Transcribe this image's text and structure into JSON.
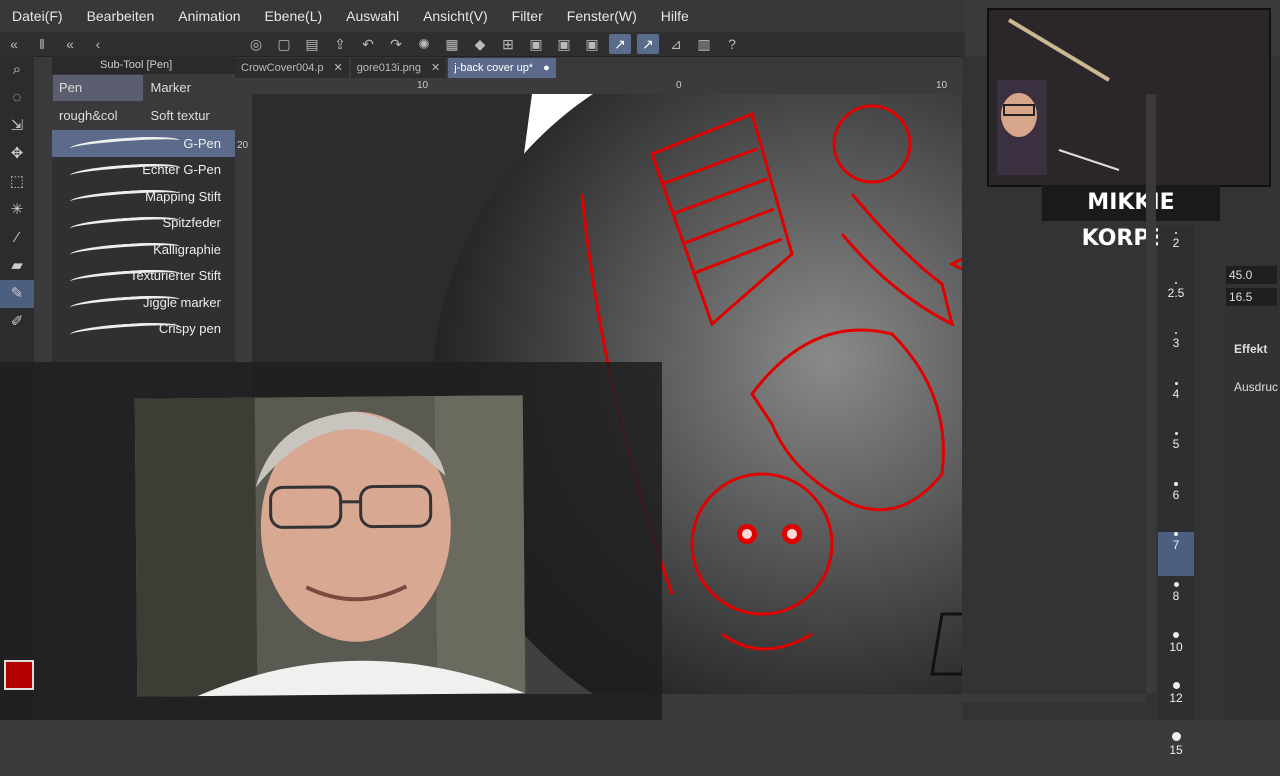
{
  "menu": [
    "Datei(F)",
    "Bearbeiten",
    "Animation",
    "Ebene(L)",
    "Auswahl",
    "Ansicht(V)",
    "Filter",
    "Fenster(W)",
    "Hilfe"
  ],
  "subtool": {
    "header": "Sub-Tool [Pen]",
    "tabs_row1": [
      "Pen",
      "Marker"
    ],
    "tabs_row2": [
      "rough&col",
      "Soft textur"
    ],
    "brushes": [
      "G-Pen",
      "Echter G-Pen",
      "Mapping Stift",
      "Spitzfeder",
      "Kalligraphie",
      "Texturierter Stift",
      "Jiggle marker",
      "Crispy pen"
    ]
  },
  "tabs": [
    {
      "label": "CrowCover004.p",
      "close": "✕"
    },
    {
      "label": "gore013i.png",
      "close": "✕"
    },
    {
      "label": "j-back cover up*",
      "close": "●"
    }
  ],
  "ruler": {
    "h": [
      "10",
      "0",
      "10"
    ],
    "v": "20"
  },
  "streamer": {
    "name": "MIKKIE KORPSE"
  },
  "brush_sizes": [
    "2",
    "2.5",
    "3",
    "4",
    "5",
    "6",
    "7",
    "8",
    "10",
    "12",
    "15"
  ],
  "props": {
    "value1": "45.0",
    "value2": "16.5",
    "effect": "Effekt",
    "expression": "Ausdruc"
  },
  "colors": {
    "accent": "#5b6a8a",
    "red": "#d10000",
    "panel": "#303033"
  }
}
